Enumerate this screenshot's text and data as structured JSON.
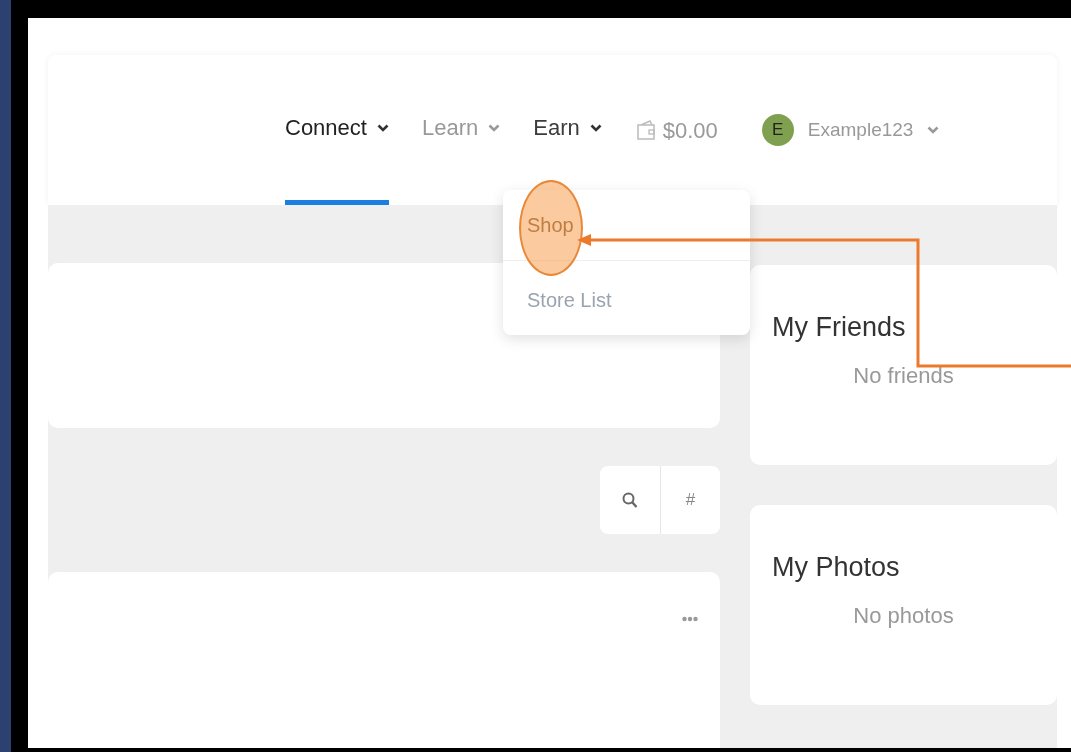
{
  "nav": [
    {
      "label": "Connect",
      "selected": true,
      "expanded": false
    },
    {
      "label": "Learn",
      "selected": false,
      "expanded": false
    },
    {
      "label": "Earn",
      "selected": false,
      "expanded": true
    }
  ],
  "wallet": {
    "balance": "$0.00"
  },
  "user": {
    "initial": "E",
    "name": "Example123"
  },
  "dropdown": {
    "items": [
      {
        "label": "Shop",
        "highlighted": true
      },
      {
        "label": "Store List",
        "highlighted": false
      }
    ]
  },
  "tools": {
    "hash_label": "#"
  },
  "widgets": [
    {
      "title": "My Friends",
      "empty_text": "No friends"
    },
    {
      "title": "My Photos",
      "empty_text": "No photos"
    }
  ]
}
